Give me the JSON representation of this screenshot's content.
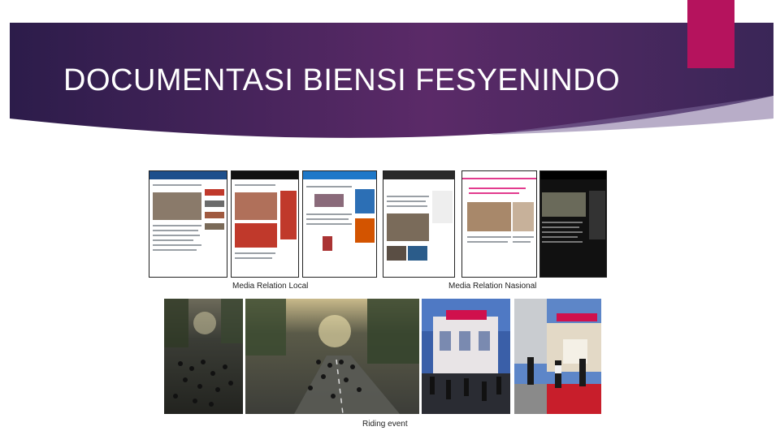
{
  "slide": {
    "title": "DOCUMENTASI BIENSI FESYENINDO",
    "colors": {
      "banner_dark": "#2e1f4f",
      "banner_mid": "#5a2a66",
      "accent": "#b5135d"
    }
  },
  "captions": {
    "media_local": "Media Relation Local",
    "media_national": "Media Relation Nasional",
    "riding": "Riding event"
  }
}
